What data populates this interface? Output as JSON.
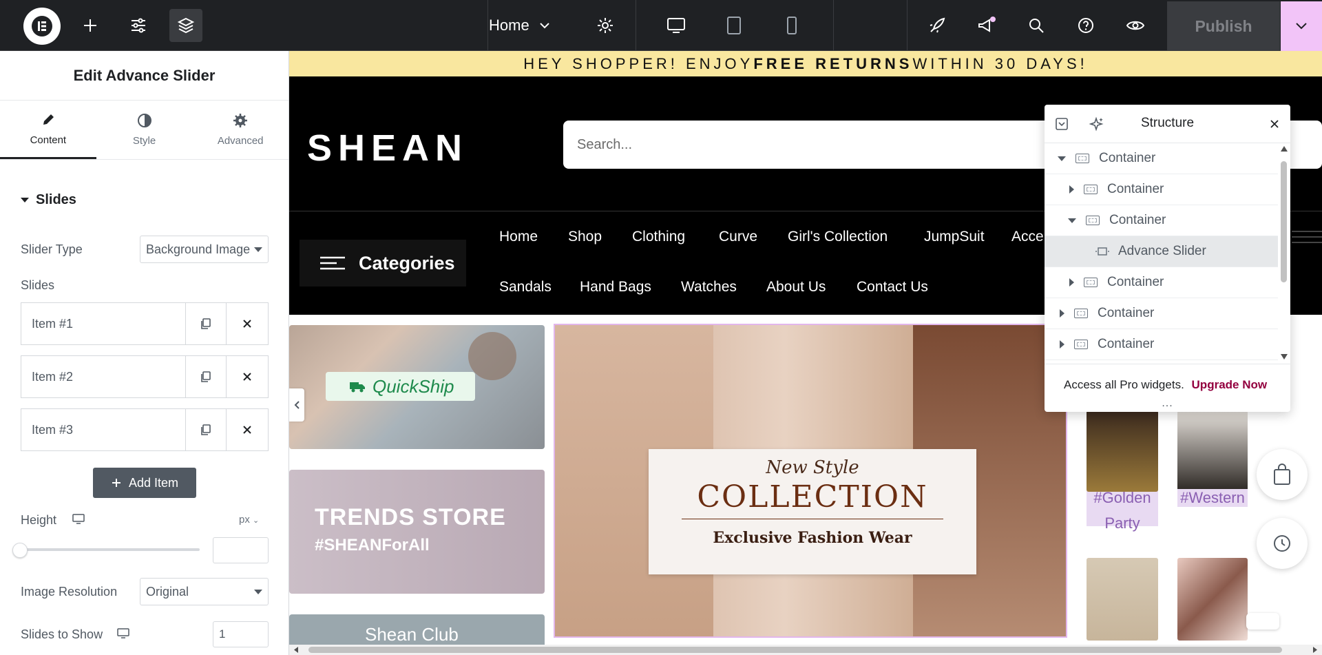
{
  "topbar": {
    "page_name": "Home",
    "publish_label": "Publish"
  },
  "panel": {
    "title": "Edit Advance Slider",
    "tabs": [
      {
        "label": "Content",
        "icon": "pencil-icon",
        "active": true
      },
      {
        "label": "Style",
        "icon": "contrast-icon",
        "active": false
      },
      {
        "label": "Advanced",
        "icon": "gear-icon",
        "active": false
      }
    ],
    "section_title": "Slides",
    "slider_type_label": "Slider Type",
    "slider_type_value": "Background Image",
    "slides_label": "Slides",
    "items": [
      "Item #1",
      "Item #2",
      "Item #3"
    ],
    "add_item_label": "Add Item",
    "height_label": "Height",
    "height_unit": "px",
    "height_value": "",
    "image_resolution_label": "Image Resolution",
    "image_resolution_value": "Original",
    "slides_to_show_label": "Slides to Show",
    "slides_to_show_value": "1"
  },
  "site": {
    "announcement_pre": "HEY SHOPPER! ENJOY ",
    "announcement_bold": "FREE RETURNS",
    "announcement_post": " WITHIN 30 DAYS!",
    "brand": "SHEAN",
    "search_placeholder": "Search...",
    "categories_label": "Categories",
    "nav_row1": [
      "Home",
      "Shop",
      "Clothing",
      "Curve",
      "Girl's Collection",
      "JumpSuit",
      "Acce"
    ],
    "nav_row2": [
      "Sandals",
      "Hand Bags",
      "Watches",
      "About Us",
      "Contact Us"
    ],
    "quickship_label": "QuickShip",
    "trends_title": "TRENDS STORE",
    "trends_tag": "#SHEANForAll",
    "club_title": "Shean Club",
    "slide_subtitle": "New Style",
    "slide_title": "COLLECTION",
    "slide_tagline": "Exclusive Fashion Wear",
    "tag_golden": "#Golden",
    "tag_golden_2": "Party",
    "tag_western": "#Western"
  },
  "structure": {
    "title": "Structure",
    "rows": [
      {
        "label": "Container",
        "arrow": "down",
        "indent": 0
      },
      {
        "label": "Container",
        "arrow": "right",
        "indent": 1
      },
      {
        "label": "Container",
        "arrow": "down",
        "indent": 1
      },
      {
        "label": "Advance Slider",
        "arrow": "none",
        "indent": 2,
        "selected": true
      },
      {
        "label": "Container",
        "arrow": "right",
        "indent": 1
      },
      {
        "label": "Container",
        "arrow": "right",
        "indent": 0
      },
      {
        "label": "Container",
        "arrow": "right",
        "indent": 0
      }
    ],
    "pro_text": "Access all Pro widgets.",
    "pro_link": "Upgrade Now",
    "dots": "..."
  },
  "colors": {
    "topbar_bg": "#1f2124",
    "publish_accent": "#f2c4f8",
    "announcement_bg": "#f9e79f",
    "brand_link": "#93003f",
    "tag_purple": "#8a5fb2"
  }
}
